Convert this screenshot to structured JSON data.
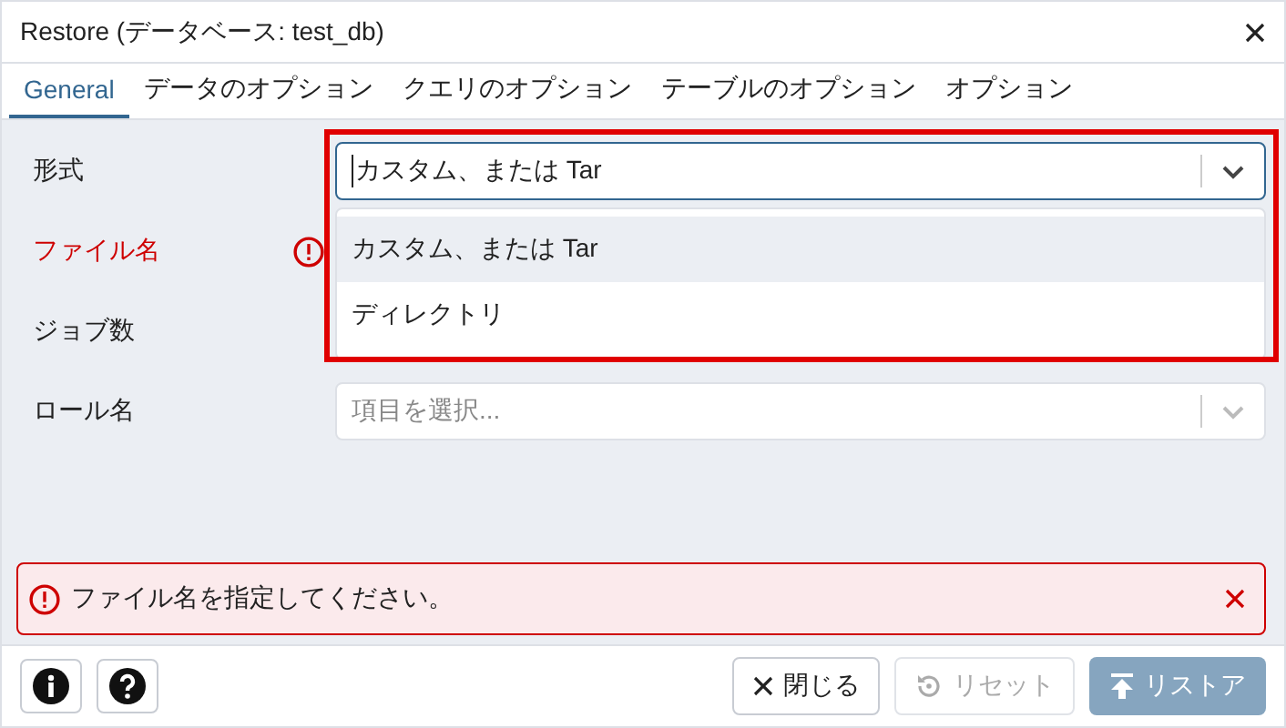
{
  "window": {
    "title": "Restore (データベース: test_db)"
  },
  "tabs": [
    {
      "label": "General",
      "selected": true
    },
    {
      "label": "データのオプション",
      "selected": false
    },
    {
      "label": "クエリのオプション",
      "selected": false
    },
    {
      "label": "テーブルのオプション",
      "selected": false
    },
    {
      "label": "オプション",
      "selected": false
    }
  ],
  "fields": [
    {
      "label": "形式",
      "error": false,
      "control": {
        "value": "カスタム、または Tar",
        "focused": true,
        "options": [
          {
            "label": "カスタム、または Tar",
            "selected": true
          },
          {
            "label": "ディレクトリ",
            "selected": false
          }
        ]
      }
    },
    {
      "label": "ファイル名",
      "error": true
    },
    {
      "label": "ジョブ数",
      "error": false
    },
    {
      "label": "ロール名",
      "error": false,
      "control": {
        "placeholder": "項目を選択...",
        "focused": false
      }
    }
  ],
  "error_banner": {
    "message": "ファイル名を指定してください。"
  },
  "footer": {
    "buttons": [
      {
        "kind": "close",
        "label": "閉じる",
        "disabled": false
      },
      {
        "kind": "reset",
        "label": "リセット",
        "disabled": true
      },
      {
        "kind": "restore",
        "label": "リストア",
        "disabled": true
      }
    ]
  }
}
